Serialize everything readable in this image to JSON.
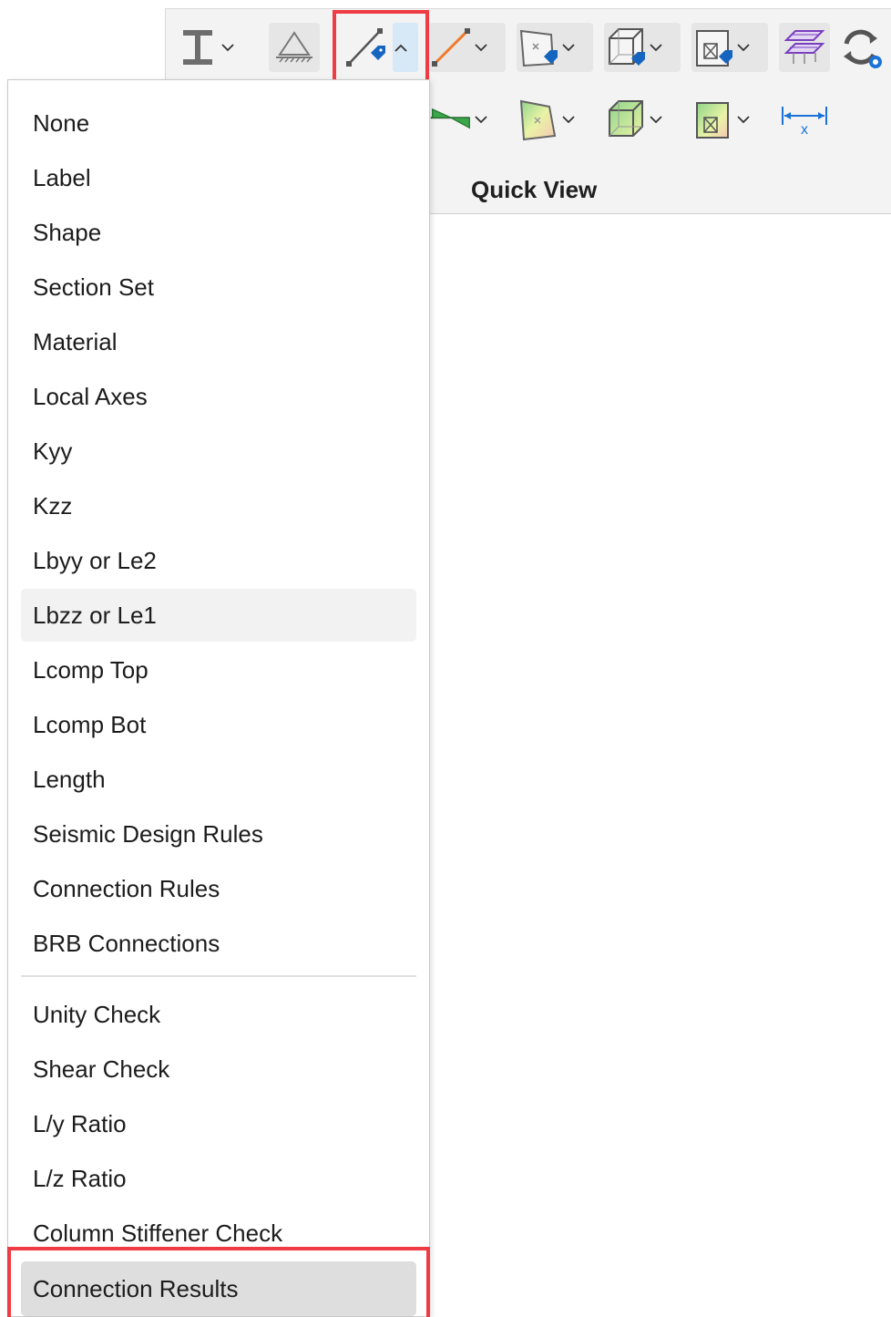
{
  "ribbon": {
    "group_label": "Quick View",
    "row1_icons": [
      "i-beam-icon",
      "support-icon",
      "member-tag-icon",
      "member-line-icon",
      "panel-tag-icon",
      "solid-tag-icon",
      "wall-tag-icon",
      "floor-layers-icon",
      "refresh-view-icon"
    ],
    "row2_icons": [
      "member-diagram-icon",
      "panel-contour-icon",
      "solid-contour-icon",
      "wall-contour-icon",
      "dimension-icon"
    ]
  },
  "menu": {
    "items": [
      "None",
      "Label",
      "Shape",
      "Section Set",
      "Material",
      "Local Axes",
      "Kyy",
      "Kzz",
      "Lbyy or Le2",
      "Lbzz or Le1",
      "Lcomp Top",
      "Lcomp Bot",
      "Length",
      "Seismic Design Rules",
      "Connection Rules",
      "BRB Connections"
    ],
    "results": [
      "Unity Check",
      "Shear Check",
      "L/y Ratio",
      "L/z Ratio",
      "Column Stiffener Check",
      "Connection Results"
    ],
    "hovered": "Lbzz or Le1",
    "selected": "Connection Results"
  },
  "colors": {
    "highlight_outline": "#ef3b43",
    "accent_blue": "#1a73d9",
    "tag_blue": "#1565c0",
    "orange_line": "#f07a2a",
    "green": "#3aa84a",
    "purple": "#7a3fbf"
  }
}
